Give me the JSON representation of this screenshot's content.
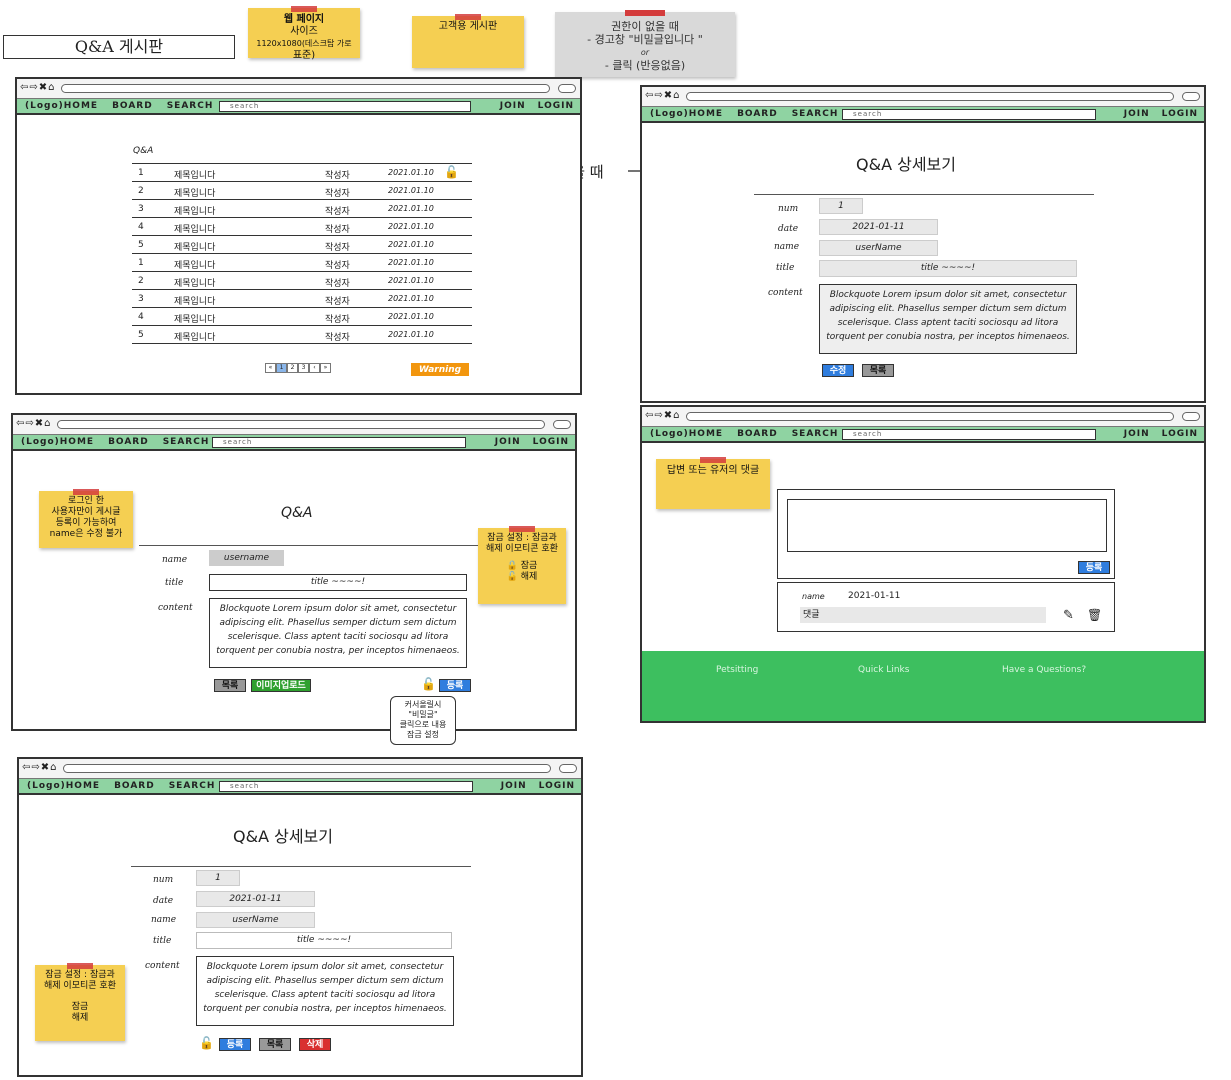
{
  "page_title": "Q&A 게시판",
  "notes": {
    "web_size": [
      "웹 페이지",
      "사이즈",
      "1120x1080(데스크탑 가로",
      "표준)"
    ],
    "customer_board": "고객용 게시판",
    "no_permission": [
      "권한이 없을 때",
      "- 경고창 \"비밀글입니다 \"",
      "or",
      "- 클릭 (반응없음)"
    ],
    "has_permission": "권한이있을 때",
    "login_only": [
      "로그인 한",
      "사용자만이 게시글",
      "등록이 가능하여",
      "name은 수정 불가"
    ],
    "lock_setting": [
      "잠금 설정 : 잠금과",
      "해제 이모티콘 호환"
    ],
    "lock_label": "잠금",
    "unlock_label": "해제",
    "tooltip": [
      "커서올릴시",
      "\"비밀글\"",
      "클릭으로 내용",
      "잠금 설정"
    ],
    "reply_note": "답변 또는 유저의 댓글"
  },
  "nav": {
    "home": "(Logo)HOME",
    "board": "BOARD",
    "search": "SEARCH",
    "search_placeholder": "search",
    "join": "JOIN",
    "login": "LOGIN"
  },
  "list": {
    "heading": "Q&A",
    "rows": [
      {
        "num": "1",
        "title": "제목입니다",
        "writer": "작성자",
        "date": "2021.01.10"
      },
      {
        "num": "2",
        "title": "제목입니다",
        "writer": "작성자",
        "date": "2021.01.10"
      },
      {
        "num": "3",
        "title": "제목입니다",
        "writer": "작성자",
        "date": "2021.01.10"
      },
      {
        "num": "4",
        "title": "제목입니다",
        "writer": "작성자",
        "date": "2021.01.10"
      },
      {
        "num": "5",
        "title": "제목입니다",
        "writer": "작성자",
        "date": "2021.01.10"
      },
      {
        "num": "1",
        "title": "제목입니다",
        "writer": "작성자",
        "date": "2021.01.10"
      },
      {
        "num": "2",
        "title": "제목입니다",
        "writer": "작성자",
        "date": "2021.01.10"
      },
      {
        "num": "3",
        "title": "제목입니다",
        "writer": "작성자",
        "date": "2021.01.10"
      },
      {
        "num": "4",
        "title": "제목입니다",
        "writer": "작성자",
        "date": "2021.01.10"
      },
      {
        "num": "5",
        "title": "제목입니다",
        "writer": "작성자",
        "date": "2021.01.10"
      }
    ],
    "pages": [
      "«",
      "1",
      "2",
      "3",
      "‹",
      "»"
    ],
    "warning": "Warning"
  },
  "detail": {
    "heading": "Q&A 상세보기",
    "labels": {
      "num": "num",
      "date": "date",
      "name": "name",
      "title": "title",
      "content": "content"
    },
    "num": "1",
    "date": "2021-01-11",
    "name": "userName",
    "title": "title ~~~~!",
    "content": "Blockquote Lorem ipsum dolor sit amet, consectetur adipiscing elit. Phasellus semper dictum sem dictum scelerisque. Class aptent taciti sociosqu ad litora torquent per conubia nostra, per inceptos himenaeos."
  },
  "write": {
    "heading": "Q&A",
    "name": "username",
    "title": "title ~~~~!"
  },
  "buttons": {
    "edit": "수정",
    "list": "목록",
    "upload": "이미지업로드",
    "register": "등록",
    "delete": "삭제"
  },
  "comment": {
    "name": "name",
    "date": "2021-01-11",
    "text": "댓글"
  },
  "footer": {
    "brand": "Petsitting",
    "links": "Quick Links",
    "question": "Have a Questions?"
  },
  "colors": {
    "nav": "#8fd3a2",
    "note": "#f5cf52",
    "footer": "#3dbf5f",
    "primary": "#2f7dde"
  }
}
